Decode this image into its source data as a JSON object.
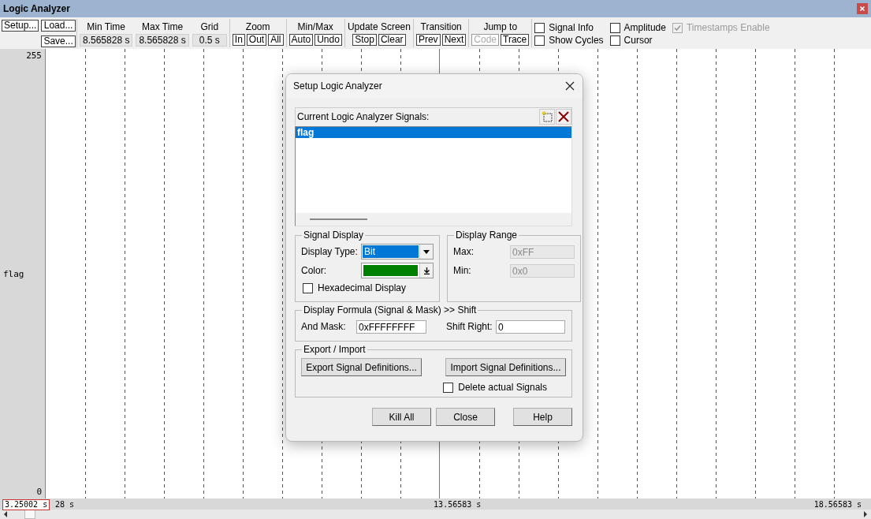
{
  "window": {
    "title": "Logic Analyzer"
  },
  "toolbar": {
    "file_buttons": [
      {
        "label": "Setup..."
      },
      {
        "label": "Load..."
      },
      {
        "label": "Save..."
      }
    ],
    "readouts": [
      {
        "label": "Min Time",
        "value": "8.565828 s"
      },
      {
        "label": "Max Time",
        "value": "8.565828 s"
      },
      {
        "label": "Grid",
        "value": "0.5 s"
      }
    ],
    "groups": [
      {
        "title": "Zoom",
        "buttons": [
          {
            "label": "In",
            "disabled": false
          },
          {
            "label": "Out",
            "disabled": false
          },
          {
            "label": "All",
            "disabled": false
          }
        ]
      },
      {
        "title": "Min/Max",
        "buttons": [
          {
            "label": "Auto",
            "disabled": false
          },
          {
            "label": "Undo",
            "disabled": false
          }
        ]
      },
      {
        "title": "Update Screen",
        "buttons": [
          {
            "label": "Stop",
            "disabled": false
          },
          {
            "label": "Clear",
            "disabled": false
          }
        ]
      },
      {
        "title": "Transition",
        "buttons": [
          {
            "label": "Prev",
            "disabled": false
          },
          {
            "label": "Next",
            "disabled": false
          }
        ]
      },
      {
        "title": "Jump to",
        "buttons": [
          {
            "label": "Code",
            "disabled": true
          },
          {
            "label": "Trace",
            "disabled": false
          }
        ]
      }
    ],
    "options": [
      {
        "label": "Signal Info",
        "checked": false,
        "disabled": false
      },
      {
        "label": "Amplitude",
        "checked": false,
        "disabled": false
      },
      {
        "label": "Timestamps Enable",
        "checked": true,
        "disabled": true
      },
      {
        "label": "Show Cycles",
        "checked": false,
        "disabled": false
      },
      {
        "label": "Cursor",
        "checked": false,
        "disabled": false
      }
    ]
  },
  "plot": {
    "y_max": "255",
    "y_min": "0",
    "signal_label": "flag"
  },
  "time_axis": {
    "cursor_readout": "3.25002 s",
    "left": "28 s",
    "center": "13.56583 s",
    "right": "18.56583 s"
  },
  "dialog": {
    "title": "Setup Logic Analyzer",
    "signals_label": "Current Logic Analyzer Signals:",
    "signals": [
      {
        "name": "flag",
        "selected": true
      }
    ],
    "signal_display": {
      "title": "Signal Display",
      "type_label": "Display Type:",
      "type_value": "Bit",
      "color_label": "Color:",
      "color": "#008000",
      "hex_label": "Hexadecimal Display",
      "hex_checked": false
    },
    "display_range": {
      "title": "Display Range",
      "max_label": "Max:",
      "max_value": "0xFF",
      "min_label": "Min:",
      "min_value": "0x0",
      "disabled": true
    },
    "formula": {
      "title": "Display Formula (Signal & Mask) >> Shift",
      "mask_label": "And Mask:",
      "mask_value": "0xFFFFFFFF",
      "shift_label": "Shift Right:",
      "shift_value": "0"
    },
    "export_import": {
      "title": "Export / Import",
      "export_button": "Export Signal Definitions...",
      "import_button": "Import Signal Definitions...",
      "delete_label": "Delete actual Signals",
      "delete_checked": false
    },
    "buttons": [
      "Kill All",
      "Close",
      "Help"
    ]
  }
}
